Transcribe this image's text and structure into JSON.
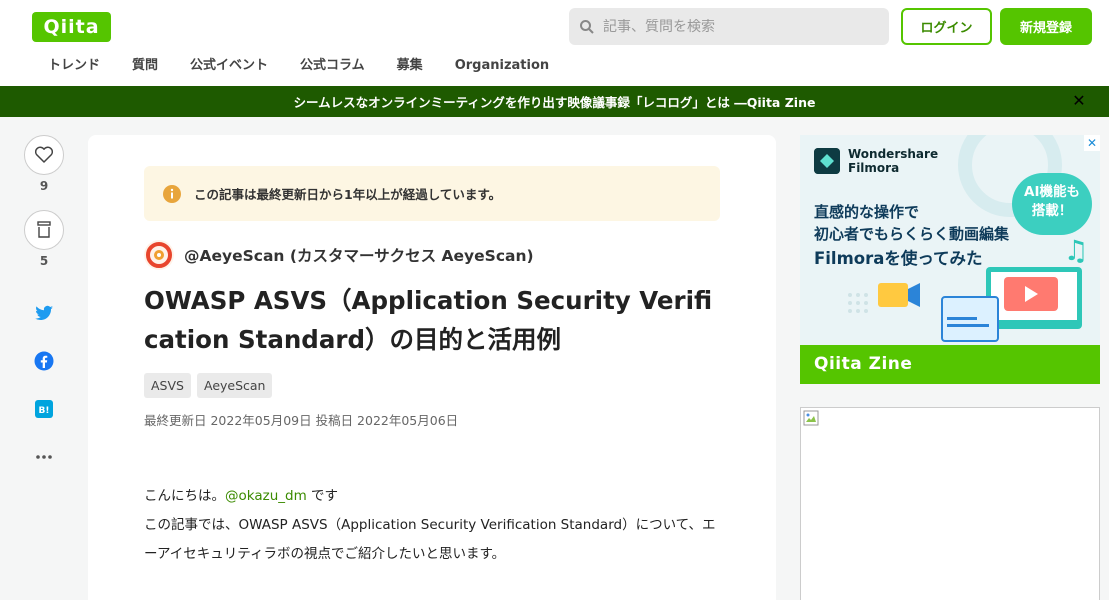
{
  "header": {
    "logo": "Qiita",
    "search_placeholder": "記事、質問を検索",
    "login": "ログイン",
    "signup": "新規登録",
    "nav": [
      "トレンド",
      "質問",
      "公式イベント",
      "公式コラム",
      "募集",
      "Organization"
    ]
  },
  "banner": {
    "text": "シームレスなオンラインミーティングを作り出す映像議事録「レコログ」とは ―Qiita Zine",
    "close": "✕"
  },
  "actions": {
    "likes": "9",
    "stocks": "5"
  },
  "article": {
    "notice": "この記事は最終更新日から1年以上が経過しています。",
    "author": "@AeyeScan (カスタマーサクセス AeyeScan)",
    "title": "OWASP ASVS（Application Security Verification Standard）の目的と活用例",
    "tags": [
      "ASVS",
      "AeyeScan"
    ],
    "dates": "最終更新日 2022年05月09日  投稿日 2022年05月06日",
    "body_greeting": "こんにちは。",
    "body_mention": "@okazu_dm",
    "body_greeting_end": " です",
    "body_line2": "この記事では、OWASP ASVS（Application Security Verification Standard）について、エーアイセキュリティラボの視点でご紹介したいと思います。"
  },
  "ad": {
    "brand": "Wondershare Filmora",
    "line1": "直感的な操作で",
    "line2": "初心者でもらくらく動画編集",
    "line3": "Filmoraを使ってみた",
    "badge_line1": "AI機能も",
    "badge_line2": "搭載！",
    "footer": "Qiita Zine",
    "close": "✕"
  },
  "colors": {
    "brand_green": "#55c500",
    "banner_bg": "#1e5a00"
  }
}
